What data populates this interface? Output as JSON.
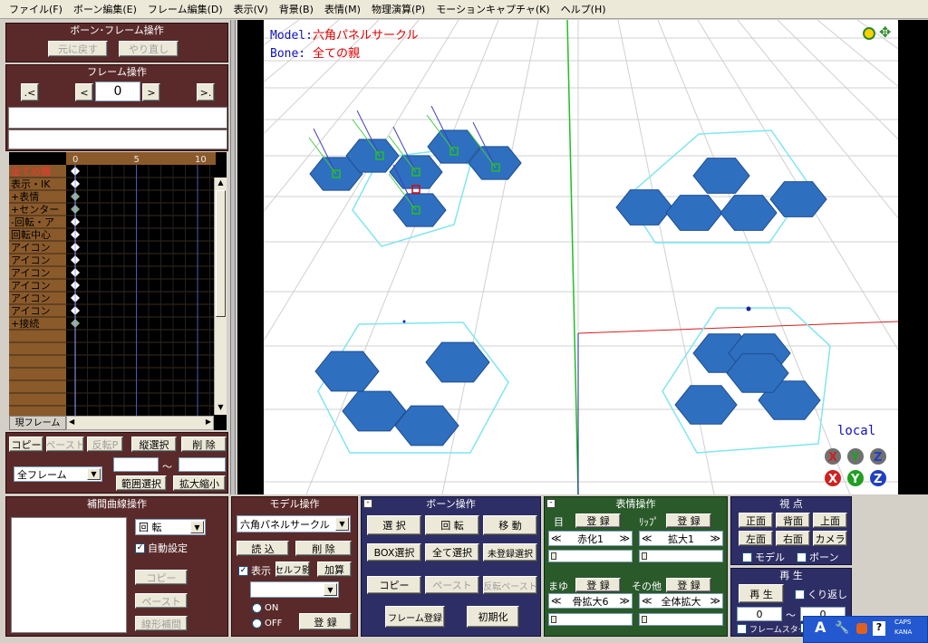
{
  "menu": [
    "ファイル(F)",
    "ボーン編集(E)",
    "フレーム編集(D)",
    "表示(V)",
    "背景(B)",
    "表情(M)",
    "物理演算(P)",
    "モーションキャプチャ(K)",
    "ヘルプ(H)"
  ],
  "bone_frame": {
    "title": "ボーン･フレーム操作",
    "undo": "元に戻す",
    "redo": "やり直し"
  },
  "frame_op": {
    "title": "フレーム操作",
    "prev_key": ".<",
    "prev": "<",
    "frame": "0",
    "next": ">",
    "next_key": ">."
  },
  "timeline": {
    "ticks": [
      "0",
      "5",
      "10"
    ],
    "rows": [
      "全ての親",
      "表示・IK",
      "+表情",
      "+センター",
      "-回転・ア",
      "回転中心",
      "アイコン",
      "アイコン",
      "アイコン",
      "アイコン",
      "アイコン",
      "アイコン",
      "+接続"
    ],
    "current_frame_label": "現フレーム"
  },
  "left_bottom": {
    "copy": "コピー",
    "paste": "ペースト",
    "reverse_paste": "反転P",
    "vertical_select": "縦選択",
    "delete": "削 除",
    "range_select_label": "全フレーム",
    "tilde": "～",
    "range_select": "範囲選択",
    "scale": "拡大縮小"
  },
  "viewport": {
    "model_label": "Model:",
    "model_name": "六角パネルサークル",
    "bone_label": "Bone:",
    "bone_name": "全ての親",
    "local": "local",
    "axis_x": "X",
    "axis_y": "Y",
    "axis_z": "Z"
  },
  "interp": {
    "title": "補間曲線操作",
    "mode": "回 転",
    "auto": "自動設定",
    "copy": "コピー",
    "paste": "ペースト",
    "linear": "線形補間"
  },
  "model_op": {
    "title": "モデル操作",
    "model": "六角パネルサークル",
    "load": "読 込",
    "delete": "削 除",
    "show": "表示",
    "self_shadow": "セルフ影",
    "add": "加算",
    "on": "ON",
    "off": "OFF",
    "register": "登 録"
  },
  "bone_op": {
    "title": "ボーン操作",
    "select": "選 択",
    "rotate": "回 転",
    "move": "移 動",
    "box_select": "BOX選択",
    "select_all": "全て選択",
    "unregistered": "未登録選択",
    "copy": "コピー",
    "paste": "ペースト",
    "reverse_paste": "反転ペースト",
    "frame_register": "フレーム登録",
    "init": "初期化"
  },
  "face_op": {
    "title": "表情操作",
    "eye": "目",
    "lip": "ﾘｯﾌﾟ",
    "register": "登 録",
    "eye_sel": "赤化1",
    "lip_sel": "拡大1",
    "brow": "まゆ",
    "other": "その他",
    "brow_sel": "骨拡大6",
    "other_sel": "全体拡大"
  },
  "viewpoint": {
    "title": "視 点",
    "front": "正面",
    "back": "背面",
    "top": "上面",
    "left": "左面",
    "right": "右面",
    "camera": "カメラ",
    "model": "モデル",
    "bone": "ボーン"
  },
  "playback": {
    "title": "再 生",
    "play": "再 生",
    "loop": "くり返し",
    "from": "0",
    "tilde": "～",
    "to": "0",
    "frame_start": "フレームスタート"
  },
  "tray": {
    "caps": "CAPS",
    "kana": "KANA"
  },
  "colors": {
    "hex": "#2f6fc0",
    "hex_edge": "#1f4f90",
    "circle": "#7fe6f0",
    "accent_red": "#e00000",
    "label_blue": "#1010c0"
  }
}
